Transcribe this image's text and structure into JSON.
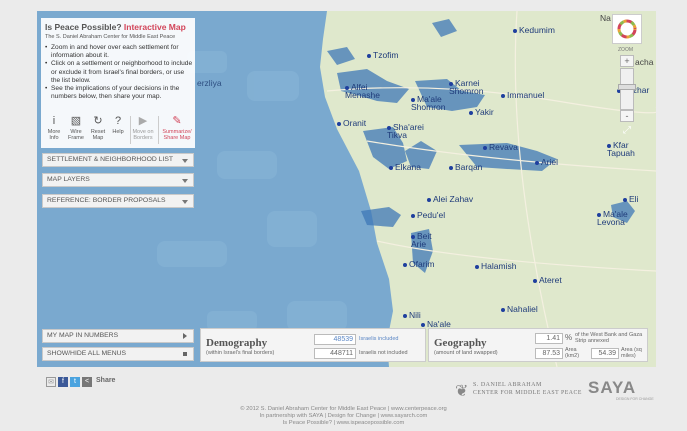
{
  "panel": {
    "title_main": "Is Peace Possible?",
    "title_accent": "Interactive Map",
    "subtitle": "The S. Daniel Abraham Center for Middle East Peace",
    "instructions": [
      "Zoom in and hover over each settlement for information about it.",
      "Click on a settlement or neighborhood to include or exclude it from Israel's final borders, or use the list below.",
      "See the implications of your decisions in the numbers below, then share your map."
    ],
    "tools": [
      {
        "icon": "info-icon",
        "glyph": "i",
        "label": "More Info"
      },
      {
        "icon": "wireframe-icon",
        "glyph": "▧",
        "label": "Wire Frame"
      },
      {
        "icon": "reset-icon",
        "glyph": "↻",
        "label": "Reset Map"
      },
      {
        "icon": "help-icon",
        "glyph": "?",
        "label": "Help"
      },
      {
        "icon": "play-icon",
        "glyph": "▶",
        "label": "Move on Borders"
      },
      {
        "icon": "share-icon",
        "glyph": "✎",
        "label": "Summarize/ Share Map"
      }
    ]
  },
  "menus": {
    "settlement_list": "SETTLEMENT & NEIGHBORHOOD LIST",
    "map_layers": "MAP LAYERS",
    "border_proposals": "REFERENCE: BORDER PROPOSALS",
    "my_map_numbers": "MY MAP IN NUMBERS",
    "show_hide_menus": "SHOW/HIDE ALL MENUS"
  },
  "zoom": {
    "label": "ZOOM",
    "plus": "+",
    "minus": "-",
    "fullscreen": "⤢"
  },
  "settlements": [
    {
      "name": "Kedumim"
    },
    {
      "name": "Tzofim"
    },
    {
      "name": "Alfei Menashe"
    },
    {
      "name": "Karnei Shomron"
    },
    {
      "name": "Immanuel"
    },
    {
      "name": "Ma'ale Shomron"
    },
    {
      "name": "Yakir"
    },
    {
      "name": "Vitzhar"
    },
    {
      "name": "Oranit"
    },
    {
      "name": "Sha'arei Tikva"
    },
    {
      "name": "Revava"
    },
    {
      "name": "Kfar Tapuah"
    },
    {
      "name": "Elkana"
    },
    {
      "name": "Barqan"
    },
    {
      "name": "Ariel"
    },
    {
      "name": "Alei Zahav"
    },
    {
      "name": "Eli"
    },
    {
      "name": "Pedu'el"
    },
    {
      "name": "Ma'ale Levona"
    },
    {
      "name": "Beit Arie"
    },
    {
      "name": "Ofarim"
    },
    {
      "name": "Halamish"
    },
    {
      "name": "Ateret"
    },
    {
      "name": "Nahaliel"
    },
    {
      "name": "Nili"
    },
    {
      "name": "Na'ale"
    }
  ],
  "map_labels": {
    "top_right": "Na",
    "right_edge": "acha",
    "left_edge": "erzliya"
  },
  "demography": {
    "title": "Demography",
    "subtitle": "(within Israel's final borders)",
    "included_value": "48539",
    "included_label": "Israelis included",
    "not_included_value": "448711",
    "not_included_label": "Israelis not included"
  },
  "geography": {
    "title": "Geography",
    "subtitle": "(amount of land swapped)",
    "percent_value": "1.41",
    "percent_symbol": "%",
    "percent_label": "of the West Bank and Gaza Strip annexed",
    "area_value_1": "87.53",
    "area_label_1": "Area (km2)",
    "area_value_2": "54.39",
    "area_label_2": "Area (sq miles)"
  },
  "share": {
    "label": "Share"
  },
  "partners": {
    "abraham_line1": "S. DANIEL ABRAHAM",
    "abraham_line2": "CENTER FOR MIDDLE EAST PEACE",
    "saya": "SAYA",
    "saya_sub": "DESIGN FOR CHANGE"
  },
  "footer": {
    "line1": "© 2012 S. Daniel Abraham Center for Middle East Peace | www.centerpeace.org",
    "line2": "In partnership with SAYA | Design for Change | www.sayarch.com",
    "line3": "Is Peace Possible? | www.ispeacepossible.com"
  },
  "colors": {
    "sea": "#7aa9cf",
    "land": "#dfe8cc",
    "settlement_blue": "#3f78b7",
    "accent_red": "#d2455a"
  }
}
